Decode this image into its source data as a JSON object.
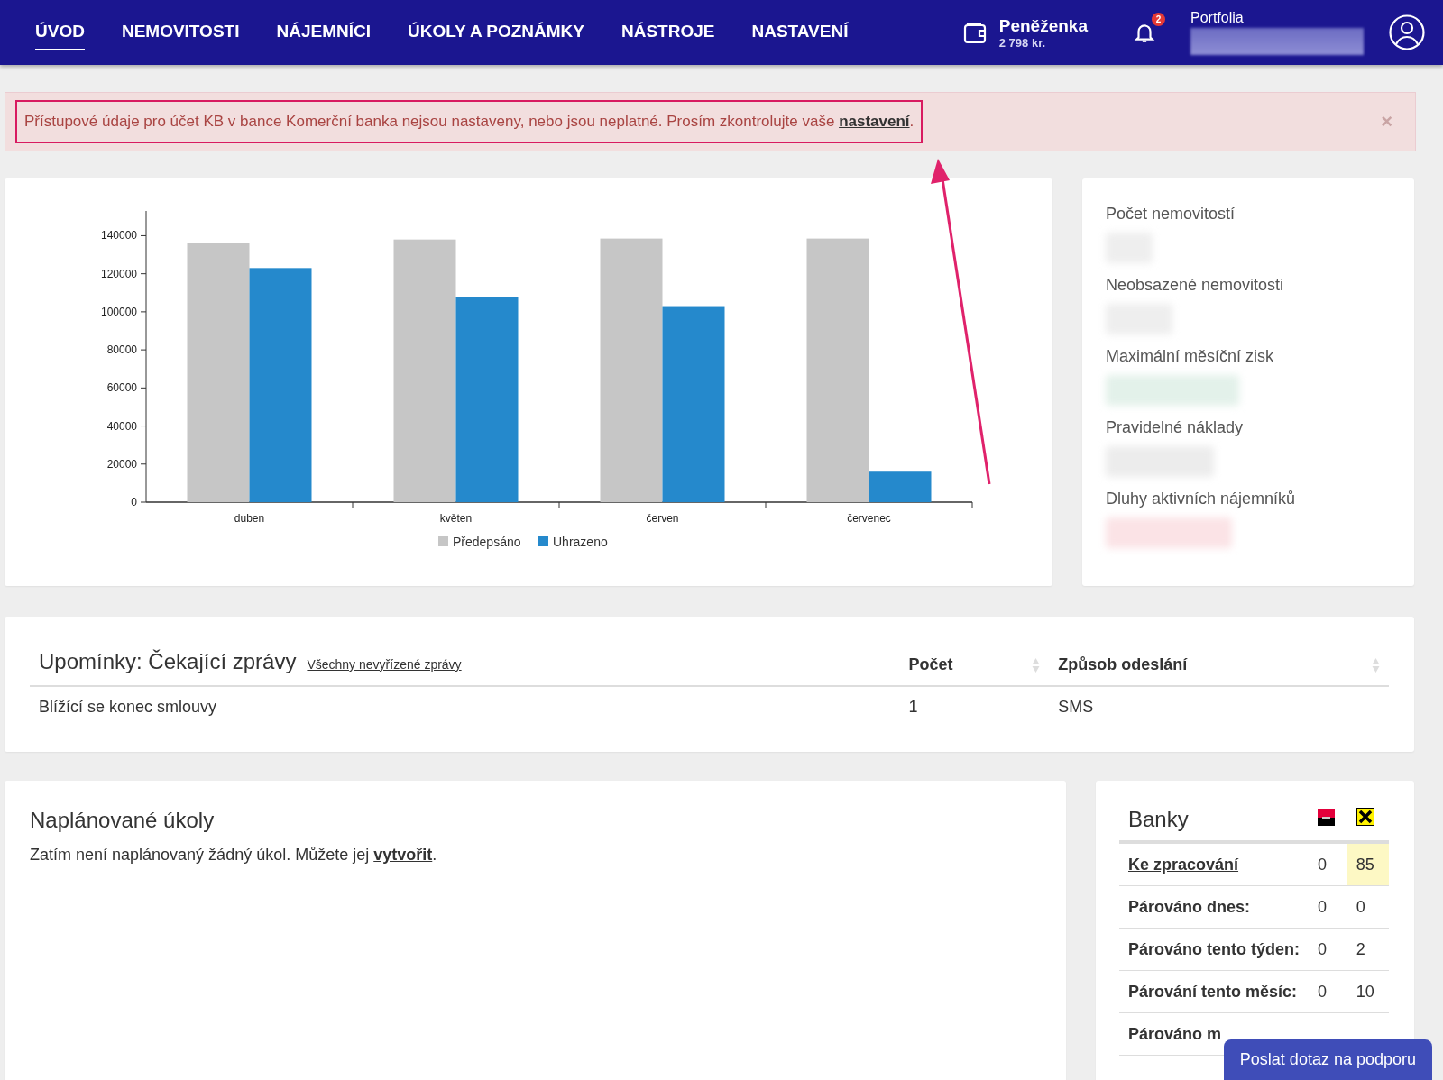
{
  "nav": {
    "items": [
      {
        "label": "ÚVOD",
        "selected": true
      },
      {
        "label": "NEMOVITOSTI",
        "selected": false
      },
      {
        "label": "NÁJEMNÍCI",
        "selected": false
      },
      {
        "label": "ÚKOLY A POZNÁMKY",
        "selected": false
      },
      {
        "label": "NÁSTROJE",
        "selected": false
      },
      {
        "label": "NASTAVENÍ",
        "selected": false
      }
    ],
    "wallet": {
      "title": "Peněženka",
      "amount": "2 798 kr."
    },
    "notifications": {
      "count": "2"
    },
    "portfolio": {
      "label": "Portfolia"
    }
  },
  "alert": {
    "text": "Přístupové údaje pro účet KB v bance Komerční banka nejsou nastaveny, nebo jsou neplatné. Prosím zkontrolujte vaše",
    "link": "nastavení",
    "end": ".",
    "close": "×"
  },
  "chart": {
    "chart_data": {
      "type": "bar",
      "categories": [
        "duben",
        "květen",
        "červen",
        "červenec"
      ],
      "series": [
        {
          "name": "Předepsáno",
          "color": "#c6c6c6",
          "values": [
            136000,
            138000,
            138500,
            138500
          ]
        },
        {
          "name": "Uhrazeno",
          "color": "#2589cc",
          "values": [
            123000,
            108000,
            103000,
            16000
          ]
        }
      ],
      "legend": "bottom",
      "ylim": [
        0,
        153000
      ],
      "yticks": [
        0,
        20000,
        40000,
        60000,
        80000,
        100000,
        120000,
        140000
      ]
    }
  },
  "stats": [
    {
      "label": "Počet nemovitostí"
    },
    {
      "label": "Neobsazené nemovitosti"
    },
    {
      "label": "Maximální měsíční zisk"
    },
    {
      "label": "Pravidelné náklady"
    },
    {
      "label": "Dluhy aktivních nájemníků"
    }
  ],
  "reminders": {
    "title": "Upomínky: Čekající zprávy",
    "link": "Všechny nevyřízené zprávy",
    "columns": [
      {},
      {
        "label": "Počet"
      },
      {
        "label": "Způsob odeslání"
      }
    ],
    "rows": [
      {
        "cells": [
          "Blížící se konec smlouvy",
          "1",
          "SMS"
        ]
      }
    ]
  },
  "tasks": {
    "title": "Naplánované úkoly",
    "text": "Zatím není naplánovaný žádný úkol. Můžete jej",
    "link": "vytvořit",
    "end": "."
  },
  "banks": {
    "title": "Banky",
    "rows": [
      {
        "label": "Ke zpracování",
        "link": true,
        "values": [
          "0",
          "85"
        ],
        "highlight": [
          false,
          true
        ]
      },
      {
        "label": "Párováno dnes:",
        "link": false,
        "values": [
          "0",
          "0"
        ],
        "highlight": [
          false,
          false
        ]
      },
      {
        "label": "Párováno tento týden:",
        "link": true,
        "values": [
          "0",
          "2"
        ],
        "highlight": [
          false,
          false
        ]
      },
      {
        "label": "Párování tento měsíc:",
        "link": false,
        "values": [
          "0",
          "10"
        ],
        "highlight": [
          false,
          false
        ]
      },
      {
        "label": "Párováno m",
        "link": false,
        "values": [],
        "highlight": []
      }
    ]
  },
  "support_button": "Poslat dotaz na podporu"
}
